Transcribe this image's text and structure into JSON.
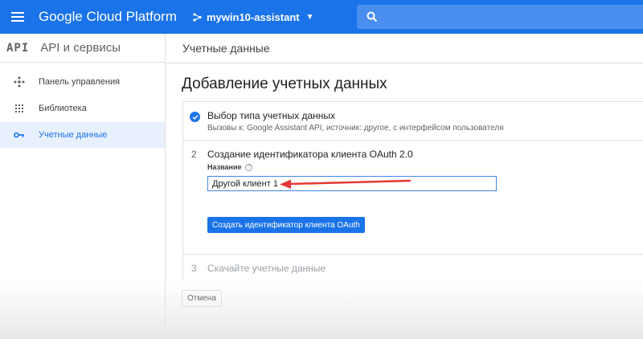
{
  "topbar": {
    "menu_icon": "hamburger-icon",
    "brand": "Google Cloud Platform",
    "project_name": "mywin10-assistant",
    "search_icon": "search-icon",
    "color": "#1a73e8"
  },
  "sidebar": {
    "logo": "API",
    "title": "API и сервисы",
    "items": [
      {
        "label": "Панель управления",
        "icon": "dashboard-icon"
      },
      {
        "label": "Библиотека",
        "icon": "library-icon"
      },
      {
        "label": "Учетные данные",
        "icon": "key-icon",
        "active": true
      }
    ]
  },
  "main": {
    "page_title": "Учетные данные",
    "heading": "Добавление учетных данных",
    "step1": {
      "title": "Выбор типа учетных данных",
      "subtitle": "Вызовы к: Google Assistant API, источник: другое, с интерфейсом пользователя"
    },
    "step2": {
      "number": "2",
      "title": "Создание идентификатора клиента OAuth 2.0",
      "name_label": "Название",
      "name_value": "Другой клиент 1",
      "create_button": "Создать идентификатор клиента OAuth"
    },
    "step3": {
      "number": "3",
      "title": "Скачайте учетные данные"
    },
    "cancel_button": "Отмена"
  }
}
